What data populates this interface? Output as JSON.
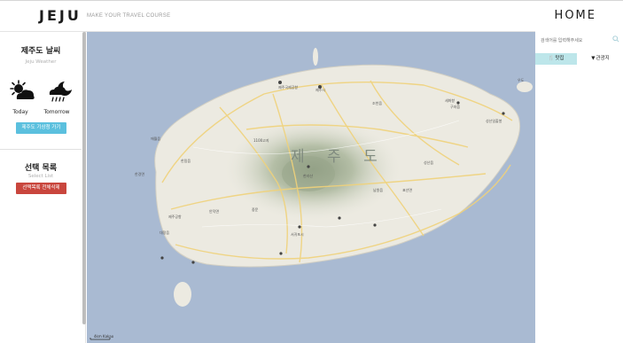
{
  "header": {
    "brand": "JEJU",
    "tagline": "MAKE YOUR TRAVEL COURSE",
    "home_label": "HOME"
  },
  "sidebar": {
    "weather": {
      "title": "제주도 날씨",
      "subtitle": "Jeju Weather",
      "today_label": "Today",
      "today_icon": "partly-cloudy-sun-icon",
      "tomorrow_label": "Tomorrow",
      "tomorrow_icon": "cloud-moon-rain-icon",
      "button_label": "제주도 기상청 가기"
    },
    "select_list": {
      "title": "선택 목록",
      "subtitle": "Select List",
      "button_label": "선택목록 전체삭제"
    }
  },
  "map": {
    "island_label": "제 주 도",
    "scale_text": "4km  Kakao",
    "place_labels": [
      "제주국제공항",
      "제주시",
      "조천읍",
      "구좌읍",
      "세화항",
      "성산읍",
      "표선면",
      "남원읍",
      "서귀포시",
      "한림읍",
      "애월읍",
      "한경면",
      "대정읍",
      "안덕면",
      "중문",
      "제주공항",
      "1100고지",
      "한라산",
      "성산일출봉",
      "우도"
    ],
    "colors": {
      "sea": "#a9bad2",
      "land": "#eceae1",
      "road": "#f0d27a"
    }
  },
  "right_panel": {
    "search_placeholder": "검색어를 입력해주세요",
    "tabs": [
      {
        "label": "맛집",
        "icon": "fork-knife-icon",
        "active": true
      },
      {
        "label": "관광지",
        "icon": "map-pin-icon",
        "active": false
      }
    ],
    "active_tab_color": "#bde6ea"
  }
}
